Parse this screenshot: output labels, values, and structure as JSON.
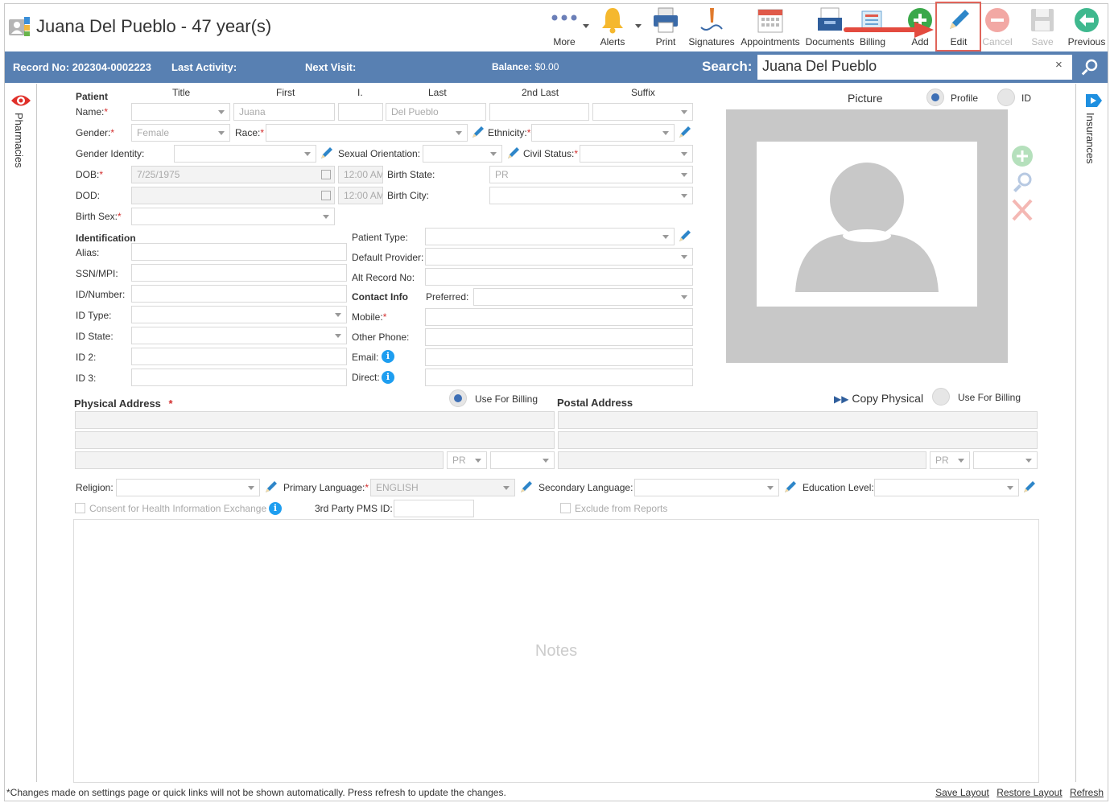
{
  "header": {
    "title": "Juana Del Pueblo - 47 year(s)"
  },
  "toolbar": {
    "more": "More",
    "alerts": "Alerts",
    "print": "Print",
    "signatures": "Signatures",
    "appointments": "Appointments",
    "documents": "Documents",
    "billing": "Billing",
    "add": "Add",
    "edit": "Edit",
    "cancel": "Cancel",
    "save": "Save",
    "previous": "Previous"
  },
  "infobar": {
    "record_label": "Record No:",
    "record_value": "202304-0002223",
    "last_activity_label": "Last Activity:",
    "next_visit_label": "Next Visit:",
    "balance_label": "Balance:",
    "balance_value": "$0.00",
    "search_label": "Search:",
    "search_value": "Juana Del Pueblo",
    "search_clear": "×"
  },
  "side": {
    "left_tab": "Pharmacies",
    "right_tab": "Insurances"
  },
  "patient": {
    "section_label": "Patient",
    "col_title": "Title",
    "col_first": "First",
    "col_initial": "I.",
    "col_last": "Last",
    "col_2nd_last": "2nd Last",
    "col_suffix": "Suffix",
    "name_label": "Name:",
    "first_value": "Juana",
    "last_value": "Del Pueblo",
    "gender_label": "Gender:",
    "gender_value": "Female",
    "race_label": "Race:",
    "ethnicity_label": "Ethnicity:",
    "gender_identity_label": "Gender Identity:",
    "sexual_orientation_label": "Sexual Orientation:",
    "civil_status_label": "Civil Status:",
    "dob_label": "DOB:",
    "dob_value": "7/25/1975",
    "dob_time": "12:00 AM",
    "birth_state_label": "Birth State:",
    "birth_state_value": "PR",
    "dod_label": "DOD:",
    "dod_time": "12:00 AM",
    "birth_city_label": "Birth City:",
    "birth_sex_label": "Birth Sex:",
    "required_mark": "*"
  },
  "identification": {
    "section_label": "Identification",
    "alias_label": "Alias:",
    "ssn_label": "SSN/MPI:",
    "id_number_label": "ID/Number:",
    "id_type_label": "ID Type:",
    "id_state_label": "ID State:",
    "id2_label": "ID 2:",
    "id3_label": "ID 3:",
    "patient_type_label": "Patient Type:",
    "default_provider_label": "Default Provider:",
    "alt_record_label": "Alt Record No:"
  },
  "contact": {
    "section_label": "Contact Info",
    "preferred_label": "Preferred:",
    "mobile_label": "Mobile:",
    "other_phone_label": "Other Phone:",
    "email_label": "Email:",
    "direct_label": "Direct:",
    "info_glyph": "i"
  },
  "picture": {
    "label": "Picture",
    "profile_option": "Profile",
    "id_option": "ID"
  },
  "address": {
    "physical_label": "Physical Address",
    "use_for_billing_1": "Use For Billing",
    "postal_label": "Postal Address",
    "copy_physical": "Copy Physical",
    "use_for_billing_2": "Use For Billing",
    "state_physical": "PR",
    "state_postal": "PR"
  },
  "misc": {
    "religion_label": "Religion:",
    "primary_language_label": "Primary Language:",
    "primary_language_value": "ENGLISH",
    "secondary_language_label": "Secondary Language:",
    "education_level_label": "Education Level:",
    "consent_label": "Consent for Health Information Exchange",
    "third_party_label": "3rd Party PMS ID:",
    "exclude_label": "Exclude from Reports",
    "notes_placeholder": "Notes"
  },
  "footer": {
    "note": "*Changes made on settings page or quick links will not be shown automatically. Press refresh to update the changes.",
    "save_layout": "Save Layout",
    "restore_layout": "Restore Layout",
    "refresh": "Refresh"
  },
  "colors": {
    "bar": "#5880b2",
    "highlight": "#e0645a",
    "required": "#d32f2f",
    "info": "#1e9ef0"
  }
}
